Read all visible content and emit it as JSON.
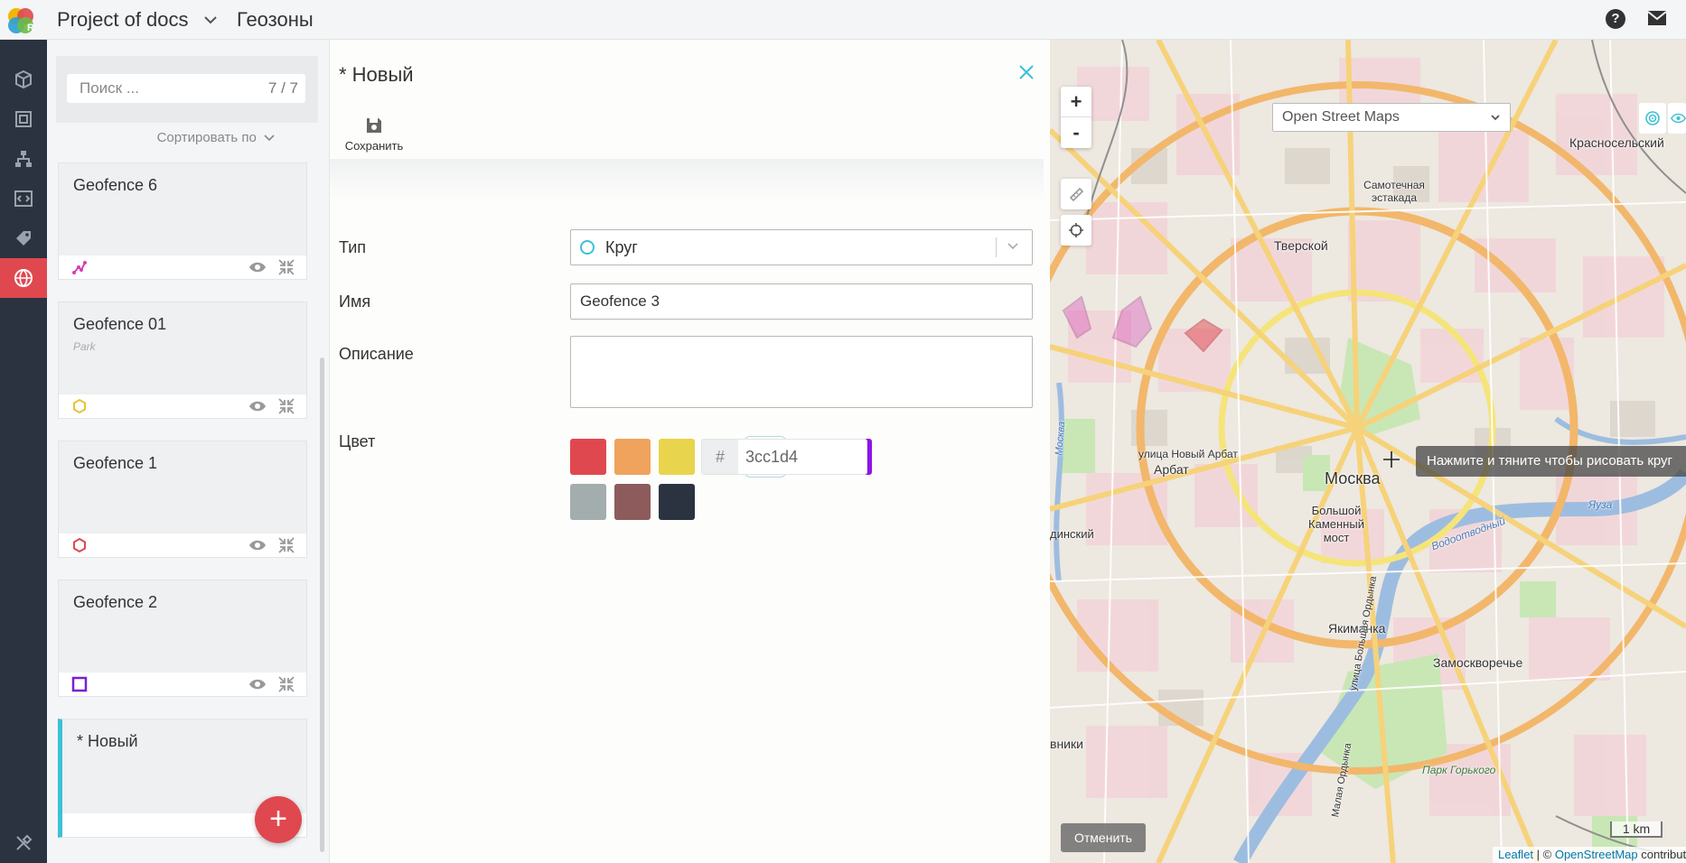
{
  "header": {
    "project_name": "Project of docs",
    "section_title": "Геозоны"
  },
  "rail": {
    "items": [
      {
        "icon": "cube-icon"
      },
      {
        "icon": "frame-icon"
      },
      {
        "icon": "hierarchy-icon"
      },
      {
        "icon": "code-icon"
      },
      {
        "icon": "tag-icon"
      },
      {
        "icon": "globe-icon",
        "active": true
      }
    ],
    "bottom_icon": "tools-icon"
  },
  "list": {
    "search_placeholder": "Поиск ...",
    "count": "7 / 7",
    "sort_label": "Сортировать по",
    "cards": [
      {
        "title": "Geofence 6",
        "subtitle": "",
        "type_icon": "polyline-icon",
        "color": "#d63fb3"
      },
      {
        "title": "Geofence 01",
        "subtitle": "Park",
        "type_icon": "hexagon-icon",
        "color": "#e6c43a"
      },
      {
        "title": "Geofence 1",
        "subtitle": "",
        "type_icon": "hexagon-icon",
        "color": "#e0484f"
      },
      {
        "title": "Geofence 2",
        "subtitle": "",
        "type_icon": "square-icon",
        "color": "#7b1fd1"
      }
    ],
    "new_card_title": "* Новый",
    "add_button": "+"
  },
  "form": {
    "title": "* Новый",
    "save_label": "Сохранить",
    "type_label": "Тип",
    "type_value": "Круг",
    "name_label": "Имя",
    "name_value": "Geofence 3",
    "description_label": "Описание",
    "description_value": "",
    "color_label": "Цвет",
    "swatches": [
      "#e0484f",
      "#f0a35c",
      "#e8d44d",
      "#a3d94a",
      "#3cc1d4",
      "#5b74d8",
      "#8f13e8",
      "#a3adad",
      "#8d5b5b",
      "#2b3340"
    ],
    "selected_swatch": 4,
    "hex_prefix": "#",
    "hex_value": "3cc1d4"
  },
  "map": {
    "layer": "Open Street Maps",
    "zoom_in": "+",
    "zoom_out": "-",
    "labels": [
      "Москва",
      "Арбат",
      "Тверской",
      "Якиманка",
      "Замоскворечье",
      "Красносельский",
      "Самотечная эстакада",
      "улица Новый Арбат",
      "Большой Каменный мост",
      "Парк Горького",
      "Водоотводный",
      "Яуза",
      "динский",
      "вники",
      "улица Большая Ордынка",
      "Малая Ордынка",
      "Москва"
    ],
    "tooltip": "Нажмите и тяните чтобы рисовать круг",
    "cancel": "Отменить",
    "scale": "1 km",
    "attribution_leaflet": "Leaflet",
    "attribution_sep": " | © ",
    "attribution_osm": "OpenStreetMap",
    "attribution_tail": " contributors"
  }
}
